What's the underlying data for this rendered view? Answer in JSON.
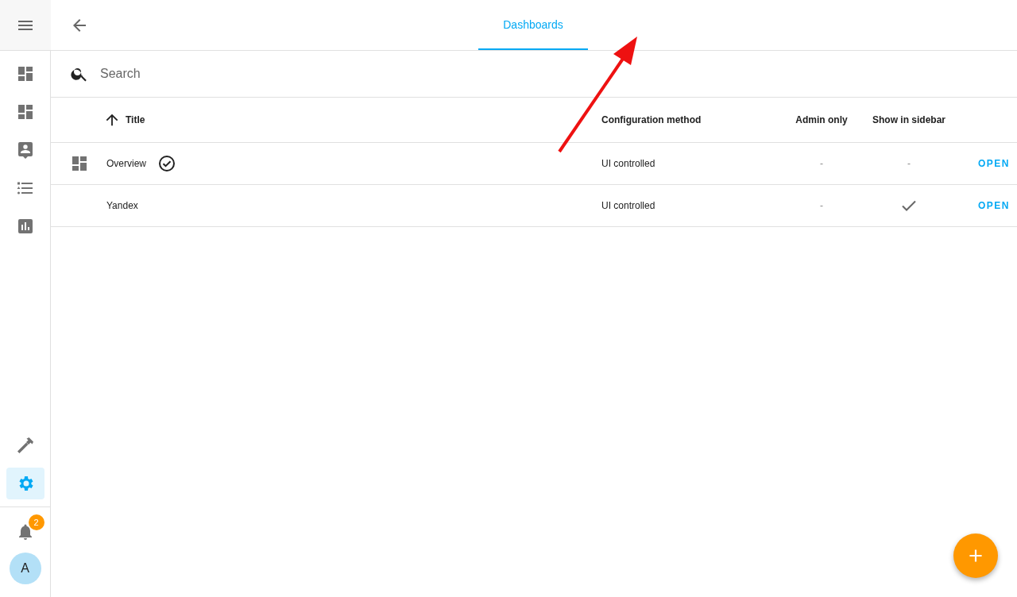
{
  "sidebar": {
    "items": [
      {
        "kind": "dashboard",
        "selected": false
      },
      {
        "kind": "dashboard",
        "selected": false
      },
      {
        "kind": "person",
        "selected": false
      },
      {
        "kind": "list",
        "selected": false
      },
      {
        "kind": "chart",
        "selected": false
      }
    ],
    "bottom_items": [
      {
        "kind": "hammer",
        "selected": false
      },
      {
        "kind": "gear",
        "selected": true
      }
    ],
    "notifications": {
      "badge": "2"
    },
    "avatar": {
      "initial": "A"
    }
  },
  "tabs": [
    {
      "label": "Dashboards",
      "selected": true
    }
  ],
  "search": {
    "placeholder": "Search"
  },
  "table": {
    "columns": [
      {
        "label": "Title",
        "sorted": true
      },
      {
        "label": "Configuration method",
        "sorted": false
      },
      {
        "label": "Admin only",
        "sorted": false
      },
      {
        "label": "Show in sidebar",
        "sorted": false
      }
    ],
    "rows": [
      {
        "has_icon": true,
        "title": "Overview",
        "default": true,
        "method": "UI controlled",
        "admin_only": "-",
        "show_in_sidebar": {
          "checked": false,
          "text": "-"
        },
        "action": "OPEN"
      },
      {
        "has_icon": false,
        "title": "Yandex",
        "default": false,
        "method": "UI controlled",
        "admin_only": "-",
        "show_in_sidebar": {
          "checked": true
        },
        "action": "OPEN"
      }
    ]
  }
}
